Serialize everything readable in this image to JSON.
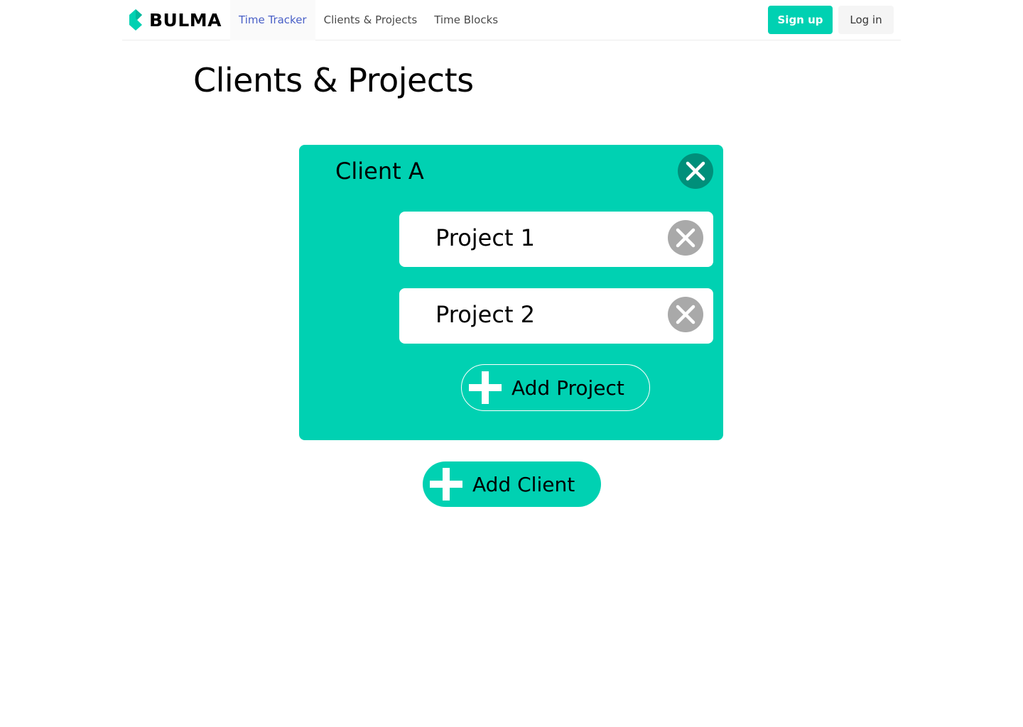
{
  "navbar": {
    "brand": "BULMA",
    "items": [
      {
        "label": "Time Tracker",
        "active": true
      },
      {
        "label": "Clients & Projects",
        "active": false
      },
      {
        "label": "Time Blocks",
        "active": false
      }
    ],
    "signup_label": "Sign up",
    "login_label": "Log in"
  },
  "page": {
    "title": "Clients & Projects"
  },
  "clients": [
    {
      "name": "Client A",
      "projects": [
        {
          "name": "Project 1"
        },
        {
          "name": "Project 2"
        }
      ],
      "add_project_label": "Add Project"
    }
  ],
  "add_client_label": "Add Client",
  "icons": {
    "brand_logo": "bulma-logo",
    "client_remove": "close-icon",
    "project_remove": "close-icon",
    "add": "plus-icon"
  },
  "colors": {
    "primary": "#00d1b2",
    "primary_dark": "#008f7a",
    "link_active": "#485fc7",
    "remove_grey": "#a9a9a9",
    "nav_text": "#4a4a4a"
  }
}
